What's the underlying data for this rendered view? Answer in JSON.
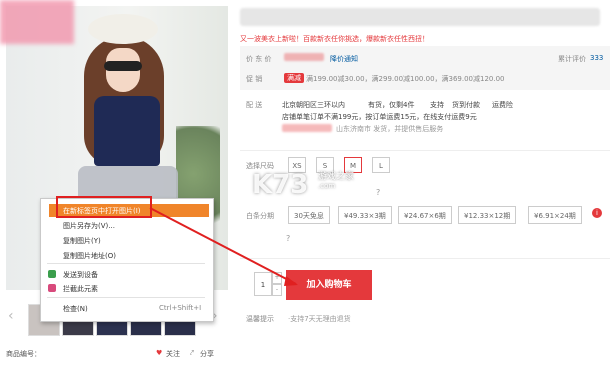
{
  "product": {
    "sub_promo": "又一波美衣上新啦！百款新衣任你挑选，爆款新衣任性西扭！",
    "price_label": "价 东 价",
    "price_notice": "降价通知",
    "review_label": "累计评价",
    "review_count": "333",
    "promo_label": "促 销",
    "promo_tag": "满减",
    "promo_text": "满199.00减30.00，满299.00减100.00，满369.00减120.00",
    "ship_from": "北京朝阳区三环以内",
    "ship_stock": "有货，仅剩4件",
    "ship_support": "支持",
    "ship_cod": "货到付款",
    "ship_return": "运费险",
    "ship_note": "店铺单笔订单不满199元，按订单运费15元，在线支付运费9元",
    "ship_from_shop": "山东济南市 发货，并提供售后服务",
    "size_label": "选择尺码",
    "sizes": [
      "XS",
      "S",
      "M",
      "L"
    ],
    "selected_size": "M",
    "installment_label": "白条分期",
    "installments": [
      "30天免息",
      "¥49.33×3期",
      "¥24.67×6期",
      "¥12.33×12期",
      "¥6.91×24期"
    ],
    "qty_value": "1",
    "qty_plus": "+",
    "qty_minus": "-",
    "add_to_cart": "加入购物车",
    "warm_tip_label": "温馨提示",
    "warm_tip_text": "·支持7天无理由退货",
    "item_code_label": "商品编号：",
    "follow": "关注",
    "share": "分享"
  },
  "context_menu": {
    "items": [
      {
        "label": "在新标签页中打开图片(I)",
        "shortcut": ""
      },
      {
        "label": "图片另存为(V)...",
        "shortcut": ""
      },
      {
        "label": "复制图片(Y)",
        "shortcut": ""
      },
      {
        "label": "复制图片地址(O)",
        "shortcut": ""
      },
      {
        "label": "发送到设备",
        "shortcut": ""
      },
      {
        "label": "拦截此元素",
        "shortcut": ""
      },
      {
        "label": "检查(N)",
        "shortcut": "Ctrl+Shift+I"
      }
    ]
  },
  "watermark": {
    "logo": "K73",
    "sub": "游戏之家",
    "url": ".com"
  },
  "colors": {
    "accent_red": "#e4393c",
    "menu_highlight": "#f0852a",
    "annotation_red": "#e02020"
  }
}
